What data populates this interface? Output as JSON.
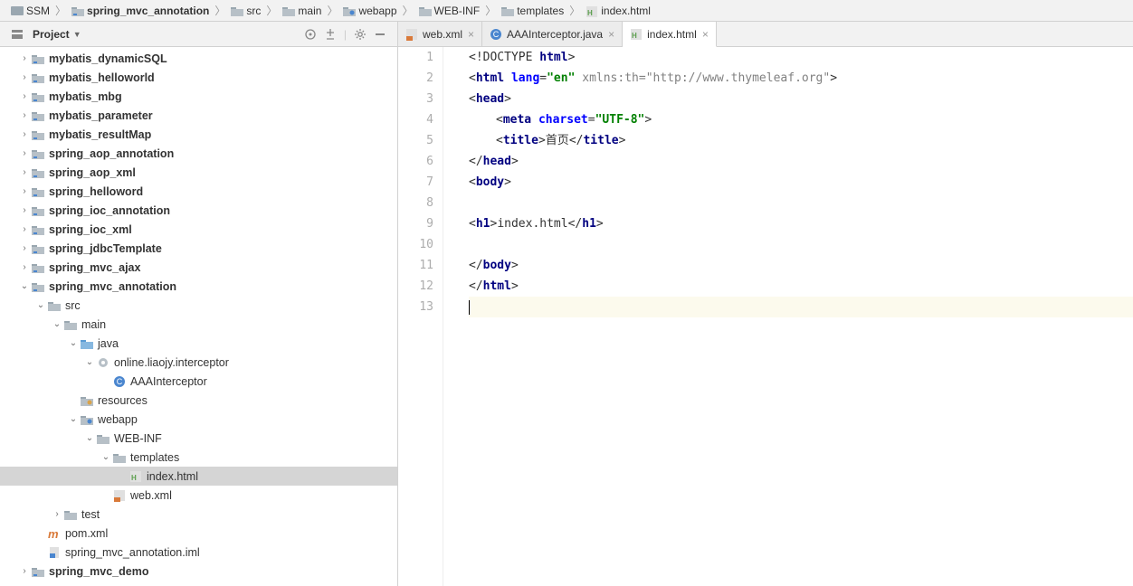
{
  "breadcrumb": [
    {
      "label": "SSM",
      "icon": "project"
    },
    {
      "label": "spring_mvc_annotation",
      "icon": "module"
    },
    {
      "label": "src",
      "icon": "folder"
    },
    {
      "label": "main",
      "icon": "folder"
    },
    {
      "label": "webapp",
      "icon": "webfolder"
    },
    {
      "label": "WEB-INF",
      "icon": "folder"
    },
    {
      "label": "templates",
      "icon": "folder"
    },
    {
      "label": "index.html",
      "icon": "html"
    }
  ],
  "projectPanel": {
    "title": "Project"
  },
  "tree": [
    {
      "depth": 0,
      "arrow": ">",
      "icon": "module",
      "label": "mybatis_dynamicSQL",
      "bold": true
    },
    {
      "depth": 0,
      "arrow": ">",
      "icon": "module",
      "label": "mybatis_helloworld",
      "bold": true
    },
    {
      "depth": 0,
      "arrow": ">",
      "icon": "module",
      "label": "mybatis_mbg",
      "bold": true
    },
    {
      "depth": 0,
      "arrow": ">",
      "icon": "module",
      "label": "mybatis_parameter",
      "bold": true
    },
    {
      "depth": 0,
      "arrow": ">",
      "icon": "module",
      "label": "mybatis_resultMap",
      "bold": true
    },
    {
      "depth": 0,
      "arrow": ">",
      "icon": "module",
      "label": "spring_aop_annotation",
      "bold": true
    },
    {
      "depth": 0,
      "arrow": ">",
      "icon": "module",
      "label": "spring_aop_xml",
      "bold": true
    },
    {
      "depth": 0,
      "arrow": ">",
      "icon": "module",
      "label": "spring_helloword",
      "bold": true
    },
    {
      "depth": 0,
      "arrow": ">",
      "icon": "module",
      "label": "spring_ioc_annotation",
      "bold": true
    },
    {
      "depth": 0,
      "arrow": ">",
      "icon": "module",
      "label": "spring_ioc_xml",
      "bold": true
    },
    {
      "depth": 0,
      "arrow": ">",
      "icon": "module",
      "label": "spring_jdbcTemplate",
      "bold": true
    },
    {
      "depth": 0,
      "arrow": ">",
      "icon": "module",
      "label": "spring_mvc_ajax",
      "bold": true
    },
    {
      "depth": 0,
      "arrow": "v",
      "icon": "module",
      "label": "spring_mvc_annotation",
      "bold": true
    },
    {
      "depth": 1,
      "arrow": "v",
      "icon": "folder",
      "label": "src"
    },
    {
      "depth": 2,
      "arrow": "v",
      "icon": "folder",
      "label": "main"
    },
    {
      "depth": 3,
      "arrow": "v",
      "icon": "srcfolder",
      "label": "java"
    },
    {
      "depth": 4,
      "arrow": "v",
      "icon": "package",
      "label": "online.liaojy.interceptor"
    },
    {
      "depth": 5,
      "arrow": "",
      "icon": "class",
      "label": "AAAInterceptor"
    },
    {
      "depth": 3,
      "arrow": "",
      "icon": "resfolder",
      "label": "resources"
    },
    {
      "depth": 3,
      "arrow": "v",
      "icon": "webfolder",
      "label": "webapp"
    },
    {
      "depth": 4,
      "arrow": "v",
      "icon": "folder",
      "label": "WEB-INF"
    },
    {
      "depth": 5,
      "arrow": "v",
      "icon": "folder",
      "label": "templates"
    },
    {
      "depth": 6,
      "arrow": "",
      "icon": "html",
      "label": "index.html",
      "selected": true
    },
    {
      "depth": 5,
      "arrow": "",
      "icon": "xml",
      "label": "web.xml"
    },
    {
      "depth": 2,
      "arrow": ">",
      "icon": "folder",
      "label": "test"
    },
    {
      "depth": 1,
      "arrow": "",
      "icon": "maven",
      "label": "pom.xml"
    },
    {
      "depth": 1,
      "arrow": "",
      "icon": "iml",
      "label": "spring_mvc_annotation.iml"
    },
    {
      "depth": 0,
      "arrow": ">",
      "icon": "module",
      "label": "spring_mvc_demo",
      "bold": true
    }
  ],
  "tabs": [
    {
      "label": "web.xml",
      "icon": "xml",
      "active": false
    },
    {
      "label": "AAAInterceptor.java",
      "icon": "class",
      "active": false
    },
    {
      "label": "index.html",
      "icon": "html",
      "active": true
    }
  ],
  "lineNumbers": [
    "1",
    "2",
    "3",
    "4",
    "5",
    "6",
    "7",
    "8",
    "9",
    "10",
    "11",
    "12",
    "13"
  ],
  "code": {
    "l1": {
      "p1": "<!DOCTYPE ",
      "p2": "html",
      "p3": ">"
    },
    "l2": {
      "p1": "<",
      "tag": "html",
      "sp": " ",
      "a1": "lang",
      "eq": "=",
      "v1": "\"en\"",
      "sp2": " ",
      "a2": "xmlns:th",
      "eq2": "=",
      "v2": "\"http://www.thymeleaf.org\"",
      "p3": ">"
    },
    "l3": {
      "p1": "<",
      "tag": "head",
      "p3": ">"
    },
    "l4": {
      "p1": "<",
      "tag": "meta",
      "sp": " ",
      "a1": "charset",
      "eq": "=",
      "v1": "\"UTF-8\"",
      "p3": ">"
    },
    "l5": {
      "p1": "<",
      "tag": "title",
      "p2": ">",
      "txt": "首页",
      "p3": "</",
      "tag2": "title",
      "p4": ">"
    },
    "l6": {
      "p1": "</",
      "tag": "head",
      "p3": ">"
    },
    "l7": {
      "p1": "<",
      "tag": "body",
      "p3": ">"
    },
    "l9": {
      "p1": "<",
      "tag": "h1",
      "p2": ">",
      "txt": "index.html",
      "p3": "</",
      "tag2": "h1",
      "p4": ">"
    },
    "l11": {
      "p1": "</",
      "tag": "body",
      "p3": ">"
    },
    "l12": {
      "p1": "</",
      "tag": "html",
      "p3": ">"
    }
  }
}
